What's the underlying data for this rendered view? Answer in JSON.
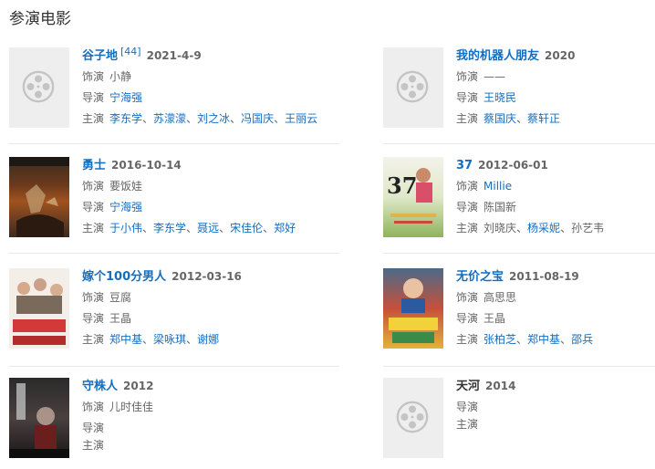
{
  "section_title": "参演电影",
  "movies": [
    {
      "title": "谷子地",
      "sup": "[44]",
      "date": "2021-4-9",
      "role_label": "饰演",
      "role": "小静",
      "director_label": "导演",
      "director": "宁海强",
      "cast_label": "主演",
      "cast": [
        "李东学",
        "苏濛濛",
        "刘之冰",
        "冯国庆",
        "王丽云"
      ],
      "poster": "placeholder"
    },
    {
      "title": "我的机器人朋友",
      "sup": "",
      "date": "2020",
      "role_label": "饰演",
      "role": "——",
      "director_label": "导演",
      "director": "王晓民",
      "cast_label": "主演",
      "cast": [
        "蔡国庆",
        "蔡轩正"
      ],
      "poster": "placeholder"
    },
    {
      "title": "勇士",
      "sup": "",
      "date": "2016-10-14",
      "role_label": "饰演",
      "role": "要饭娃",
      "director_label": "导演",
      "director": "宁海强",
      "cast_label": "主演",
      "cast": [
        "于小伟",
        "李东学",
        "聂远",
        "宋佳伦",
        "郑好"
      ],
      "poster": "dark-red"
    },
    {
      "title": "37",
      "sup": "",
      "date": "2012-06-01",
      "role_label": "饰演",
      "role": "Millie",
      "director_label": "导演",
      "director": "陈国新",
      "cast_label": "主演",
      "cast": [
        "刘晓庆",
        "杨采妮",
        "孙艺韦"
      ],
      "poster": "light-green"
    },
    {
      "title": "嫁个100分男人",
      "sup": "",
      "date": "2012-03-16",
      "role_label": "饰演",
      "role": "豆腐",
      "director_label": "导演",
      "director": "王晶",
      "cast_label": "主演",
      "cast": [
        "郑中基",
        "梁咏琪",
        "谢娜"
      ],
      "poster": "white-red"
    },
    {
      "title": "无价之宝",
      "sup": "",
      "date": "2011-08-19",
      "role_label": "饰演",
      "role": "高思思",
      "director_label": "导演",
      "director": "王晶",
      "cast_label": "主演",
      "cast": [
        "张柏芝",
        "郑中基",
        "邵兵"
      ],
      "poster": "colorful"
    },
    {
      "title": "守株人",
      "sup": "",
      "date": "2012",
      "role_label": "饰演",
      "role": "儿时佳佳",
      "director_label": "导演",
      "director": "",
      "cast_label": "主演",
      "cast": [],
      "poster": "dark-gray"
    },
    {
      "title": "天河",
      "sup": "",
      "date": "2014",
      "role_label": "",
      "role": "",
      "director_label": "导演",
      "director": "",
      "cast_label": "主演",
      "cast": [],
      "poster": "placeholder"
    }
  ]
}
